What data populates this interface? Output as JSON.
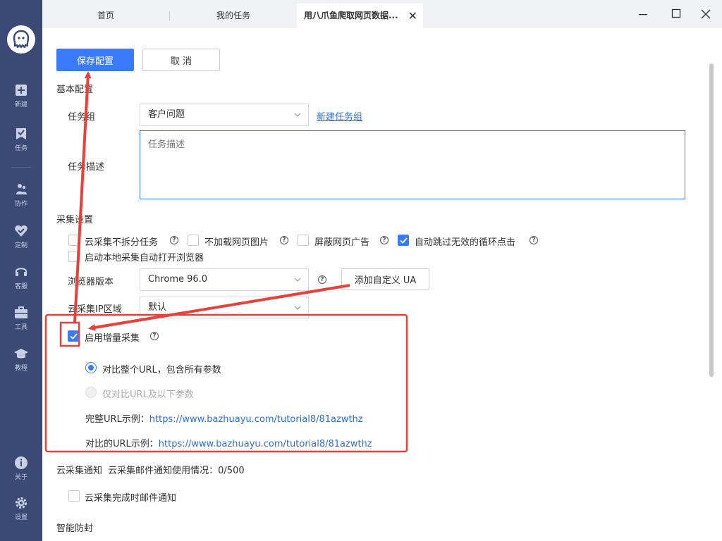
{
  "tabs": [
    {
      "label": "首页"
    },
    {
      "label": "我的任务"
    },
    {
      "label": "用八爪鱼爬取网页数据..."
    }
  ],
  "sidebar": {
    "items": [
      {
        "label": "新建",
        "icon": "plus-square-icon"
      },
      {
        "label": "任务",
        "icon": "task-check-icon"
      },
      {
        "label": "协作",
        "icon": "collaboration-icon"
      },
      {
        "label": "定制",
        "icon": "custom-heart-icon"
      },
      {
        "label": "客服",
        "icon": "headset-icon"
      },
      {
        "label": "工具",
        "icon": "toolbox-icon"
      },
      {
        "label": "教程",
        "icon": "graduation-cap-icon"
      },
      {
        "label": "关于",
        "icon": "info-icon"
      },
      {
        "label": "设置",
        "icon": "gear-icon"
      }
    ]
  },
  "toolbar": {
    "save_label": "保存配置",
    "cancel_label": "取 消"
  },
  "basic": {
    "title": "基本配置",
    "group_label": "任务组",
    "group_value": "客户问题",
    "new_group_link": "新建任务组",
    "desc_label": "任务描述",
    "desc_placeholder": "任务描述"
  },
  "collect": {
    "title": "采集设置",
    "options": [
      {
        "label": "云采集不拆分任务",
        "checked": false
      },
      {
        "label": "不加载网页图片",
        "checked": false
      },
      {
        "label": "屏蔽网页广告",
        "checked": false
      },
      {
        "label": "自动跳过无效的循环点击",
        "checked": true
      },
      {
        "label": "启动本地采集自动打开浏览器",
        "checked": false
      }
    ],
    "browser_label": "浏览器版本",
    "browser_value": "Chrome 96.0",
    "custom_ua": "添加自定义 UA",
    "ip_label": "云采集IP区域",
    "ip_value": "默认"
  },
  "incremental": {
    "label": "启用增量采集",
    "checked": true,
    "option1": "对比整个URL，包含所有参数",
    "option2": "仅对比URL及以下参数",
    "full_url_label": "完整URL示例：",
    "full_url": "https://www.bazhuayu.com/tutorial8/81azwthz",
    "compare_url_label": "对比的URL示例：",
    "compare_url": "https://www.bazhuayu.com/tutorial8/81azwthz"
  },
  "notify": {
    "title": "云采集通知",
    "usage": "云采集邮件通知使用情况：0/500",
    "email_label": "云采集完成时邮件通知"
  },
  "anti_block": {
    "title": "智能防封"
  },
  "colors": {
    "sidebar": "#3b4a75",
    "primary": "#3a7bfd",
    "annotation": "#e8413b",
    "link": "#2e6fd8"
  }
}
